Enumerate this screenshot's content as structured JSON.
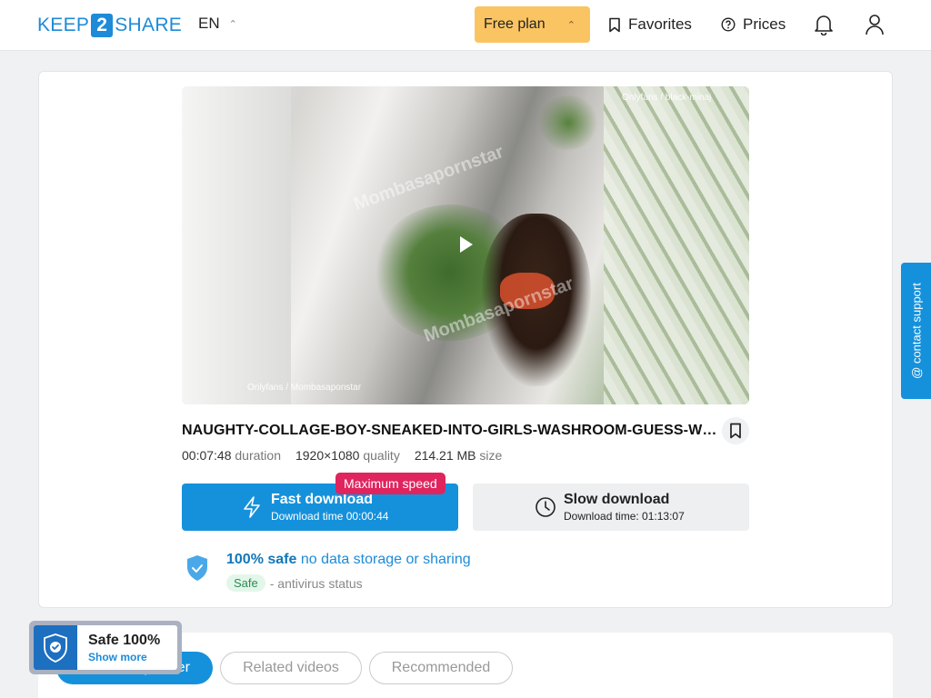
{
  "header": {
    "logo_pre": "KEEP",
    "logo_num": "2",
    "logo_post": "SHARE",
    "language": "EN",
    "plan_label": "Free plan",
    "favorites_label": "Favorites",
    "prices_label": "Prices"
  },
  "video": {
    "watermark_top": "Onlyfans / black-minaj",
    "watermark_bottom": "Onlyfans / Mombasaponstar",
    "watermark_diag_1": "Mombasapornstar",
    "watermark_diag_2": "Mombasapornstar"
  },
  "file": {
    "title": "NAUGHTY-COLLAGE-BOY-SNEAKED-INTO-GIRLS-WASHROOM-GUESS-WHAT-HAPPENED",
    "duration": "00:07:48",
    "duration_label": "duration",
    "quality": "1920×1080",
    "quality_label": "quality",
    "size": "214.21 MB",
    "size_label": "size"
  },
  "download": {
    "fast_label": "Fast download",
    "fast_time": "Download time 00:00:44",
    "max_badge": "Maximum speed",
    "slow_label": "Slow download",
    "slow_time": "Download time: 01:13:07"
  },
  "safety": {
    "strong": "100% safe",
    "light": "no data storage or sharing",
    "pill": "Safe",
    "status": "- antivirus status"
  },
  "support": {
    "label": "@ contact support"
  },
  "tabs": [
    {
      "label": "From this partner"
    },
    {
      "label": "Related videos"
    },
    {
      "label": "Recommended"
    }
  ],
  "safe_widget": {
    "title": "Safe 100%",
    "link": "Show more"
  },
  "colors": {
    "accent": "#1591dc",
    "plan": "#fbc462",
    "badge": "#e0245e"
  }
}
